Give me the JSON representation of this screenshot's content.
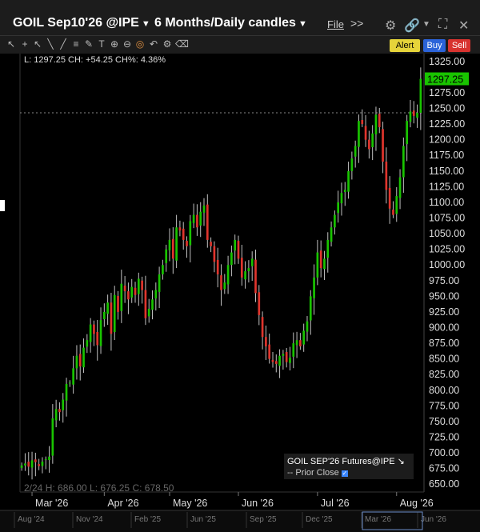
{
  "window": {
    "title": "GOIL Sep10'26 @IPE",
    "period": "6 Months/Daily candles",
    "menu_file": "File",
    "menu_more": ">>"
  },
  "buttons": {
    "alert": "Alert",
    "buy": "Buy",
    "sell": "Sell"
  },
  "ohlc_top": "L: 1297.25 CH: +54.25 CH%: 4.36%",
  "ohlc_bottom": "2/24  H: 686.00  L: 676.25  C: 678.50",
  "legend": {
    "title": "GOIL SEP'26 Futures@IPE",
    "prior_close": "Prior Close"
  },
  "colors": {
    "up": "#19c400",
    "down": "#e0352d",
    "wick": "#c0c0c0",
    "last_price_bg": "#19c400",
    "alert": "#e6d43a",
    "buy": "#2b63d9",
    "sell": "#d8332f"
  },
  "icons": [
    "gear-icon",
    "link-icon",
    "dropdown-icon",
    "expand-icon",
    "close-icon"
  ],
  "chart_data": {
    "type": "candlestick",
    "ylim": [
      637.5,
      1337.5
    ],
    "y_ticks": [
      1325,
      1300,
      1275,
      1250,
      1225,
      1200,
      1175,
      1150,
      1125,
      1100,
      1075,
      1050,
      1025,
      1000,
      975,
      950,
      925,
      900,
      875,
      850,
      825,
      800,
      775,
      750,
      725,
      700,
      675,
      650
    ],
    "y_tick_labels": [
      "1325.00",
      "1300.00",
      "1275.00",
      "1250.00",
      "1225.00",
      "1200.00",
      "1175.00",
      "1150.00",
      "1125.00",
      "1100.00",
      "1075.00",
      "1050.00",
      "1025.00",
      "1000.00",
      "975.00",
      "950.00",
      "925.00",
      "900.00",
      "875.00",
      "850.00",
      "825.00",
      "800.00",
      "775.00",
      "750.00",
      "725.00",
      "700.00",
      "675.00",
      "650.00"
    ],
    "last_price": 1297.25,
    "last_price_label": "1297.25",
    "prior_close": 1243.0,
    "x_months": [
      "Mar '26",
      "Apr '26",
      "May '26",
      "Jun '26",
      "Jul '26",
      "Aug '26"
    ],
    "x_month_index": [
      3,
      24,
      43,
      63,
      86,
      109
    ],
    "overview_labels": [
      "Aug '24",
      "Nov '24",
      "Feb '25",
      "Jun '25",
      "Sep '25",
      "Dec '25",
      "Mar '26",
      "Jun '26"
    ],
    "closes": [
      680,
      683,
      678,
      688,
      685,
      679,
      686,
      690,
      694,
      755,
      770,
      765,
      785,
      810,
      812,
      835,
      855,
      838,
      868,
      880,
      905,
      890,
      872,
      912,
      925,
      940,
      890,
      952,
      925,
      970,
      958,
      945,
      965,
      952,
      978,
      960,
      915,
      930,
      945,
      960,
      985,
      1000,
      1025,
      1040,
      1010,
      1060,
      1055,
      1040,
      1030,
      1070,
      1080,
      1060,
      1085,
      1095,
      1040,
      1030,
      1005,
      985,
      960,
      972,
      1000,
      1020,
      1040,
      1010,
      980,
      990,
      995,
      1010,
      955,
      920,
      885,
      870,
      850,
      845,
      842,
      855,
      858,
      845,
      852,
      875,
      880,
      870,
      895,
      910,
      950,
      980,
      1020,
      995,
      1010,
      1040,
      1060,
      1080,
      1100,
      1115,
      1120,
      1150,
      1170,
      1190,
      1230,
      1225,
      1200,
      1185,
      1210,
      1240,
      1220,
      1165,
      1120,
      1090,
      1080,
      1110,
      1140,
      1190,
      1230,
      1245,
      1238,
      1243,
      1297.25
    ]
  }
}
